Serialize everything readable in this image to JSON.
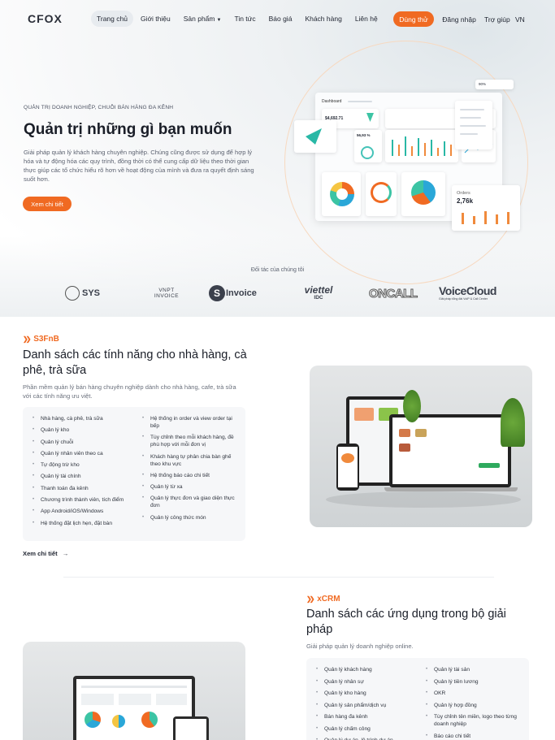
{
  "header": {
    "logo": "CFOX",
    "nav": [
      {
        "label": "Trang chủ",
        "active": true
      },
      {
        "label": "Giới thiệu"
      },
      {
        "label": "Sản phẩm",
        "dropdown": true
      },
      {
        "label": "Tin tức"
      },
      {
        "label": "Báo giá"
      },
      {
        "label": "Khách hàng"
      },
      {
        "label": "Liên hệ"
      }
    ],
    "try_label": "Dùng thử",
    "login_label": "Đăng nhập",
    "help_label": "Trợ giúp",
    "lang_label": "VN"
  },
  "hero": {
    "eyebrow": "QUẢN TRỊ DOANH NGHIỆP, CHUỖI BÁN HÀNG ĐA KÊNH",
    "title": "Quản trị những gì bạn muốn",
    "description": "Giải pháp quản lý khách hàng chuyên nghiệp. Chúng cũng được sử dụng để hợp lý hóa và tự động hóa các quy trình, đồng thời có thể cung cấp dữ liệu theo thời gian thực giúp các tổ chức hiểu rõ hơn về hoạt động của mình và đưa ra quyết định sáng suốt hơn.",
    "cta_label": "Xem chi tiết",
    "dashboard": {
      "title": "Dashboard",
      "stat1": "$4,692.71",
      "stat2": "56,93 %",
      "orders_label": "Orders",
      "orders_value": "2,76k",
      "popup_value": "90%"
    }
  },
  "partners": {
    "title": "Đối tác của chúng tôi",
    "logos": [
      "SYS",
      "VNPT INVOICE",
      "SInvoice",
      "viettel IDC",
      "ONCALL",
      "VoiceCloud"
    ],
    "sub": {
      "viettel": "IDC",
      "vnpt_top": "VNPT",
      "vnpt_bottom": "INVOICE",
      "voicecloud_tag": "Giải pháp tổng đài VoIP & Call Center"
    }
  },
  "s3fnb": {
    "tag": "S3FnB",
    "title": "Danh sách các tính năng cho nhà hàng, cà phê, trà sữa",
    "description": "Phần mềm quản lý bán hàng chuyên nghiệp dành cho nhà hàng, cafe, trà sữa với các tính năng ưu việt.",
    "features_left": [
      "Nhà hàng, cà phê, trà sữa",
      "Quản lý kho",
      "Quản lý chuỗi",
      "Quản lý nhân viên theo ca",
      "Tự động trừ kho",
      "Quản lý tài chính",
      "Thanh toán đa kênh",
      "Chương trình thành viên, tích điểm",
      "App Android/iOS/Windows",
      "Hệ thống đặt lịch hẹn, đặt bàn"
    ],
    "features_right": [
      "Hệ thống in order và view order tại bếp",
      "Tùy chỉnh theo mỗi khách hàng, đề phù hợp với mỗi đơn vị",
      "Khách hàng tự phân chia bàn ghế theo khu vực",
      "Hệ thống báo cáo chi tiết",
      "Quản lý từ xa",
      "Quản lý thực đơn và giao diện thực đơn",
      "Quản lý công thức món"
    ],
    "more_label": "Xem chi tiết"
  },
  "xcrm": {
    "tag": "xCRM",
    "title": "Danh sách các ứng dụng trong bộ giải pháp",
    "description": "Giải pháp quản lý doanh nghiệp online.",
    "features_left": [
      "Quản lý khách hàng",
      "Quản lý nhân sự",
      "Quản lý kho hàng",
      "Quản lý sản phẩm/dịch vụ",
      "Bán hàng đa kênh",
      "Quản lý chấm công",
      "Quản lý dự án, lộ trình dự án"
    ],
    "features_right": [
      "Quản lý tài sản",
      "Quản lý tiền lương",
      "OKR",
      "Quản lý hợp đồng",
      "Tùy chỉnh tên miền, logo theo từng doanh nghiệp",
      "Báo cáo chi tiết"
    ]
  },
  "colors": {
    "accent": "#f06a22",
    "text": "#1f2430",
    "muted": "#6a707c",
    "panel": "#f6f7f9"
  }
}
